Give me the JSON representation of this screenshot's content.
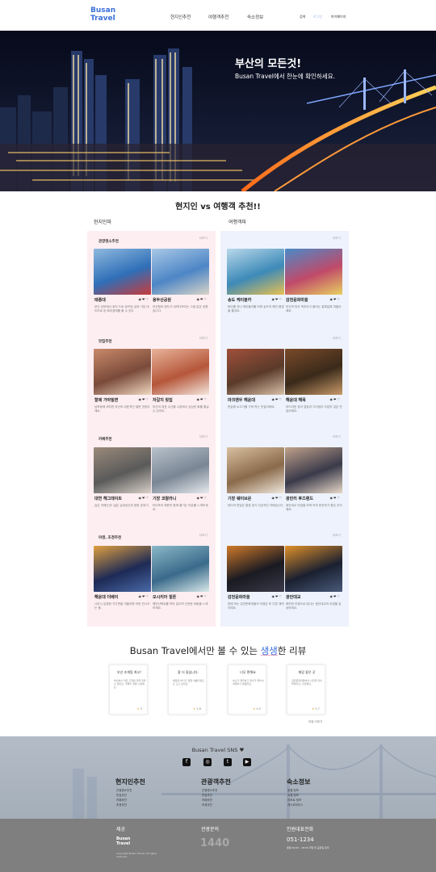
{
  "header": {
    "logo_line1": "Busan",
    "logo_line2": "Travel",
    "nav": [
      "현지인추천",
      "여행객추천",
      "숙소정보"
    ],
    "top_links": [
      "검색",
      "로그인",
      "마이페이지"
    ]
  },
  "hero": {
    "title": "부산의 모든것!",
    "subtitle": "Busan Travel에서 한눈에 확인하세요."
  },
  "recommend": {
    "title": "현지인 vs 여행객 추천!!",
    "left_label": "현지인파",
    "right_label": "여행객파",
    "more": "더보기",
    "left_categories": [
      "관광명소추천",
      "맛집추천",
      "카페추천",
      "야경, 조경추천"
    ],
    "left_cards": [
      {
        "name": "태종대",
        "desc": "부산 남부에서 위치 드로 꿈꾸었 길과 기업 대리자로 된 배이경에를 볼 수 있도"
      },
      {
        "name": "용두산공원",
        "desc": "부산항과 영도가 내려다보이는 그림 같은 공원입니다."
      },
      {
        "name": "할매 가야밀면",
        "desc": "남포동에 위치한 부산의 대표적인 밀면 맛집이에요."
      },
      {
        "name": "자갈치 횟집",
        "desc": "부산의 대표 수산물 시장에서 싱싱한 회를 즐길 수 있어요."
      },
      {
        "name": "대연 헤그데이트",
        "desc": "숨은 카페인것! 넓은 실내공간과 편한 분위기."
      },
      {
        "name": "기장 코랄라니",
        "desc": "타이포의 해변과 함께 즐기는 여유를 느껴보세요."
      },
      {
        "name": "해운대 더베이",
        "desc": "나무시 유명한 거주면을 겨울저편 어린 전시오는 품."
      },
      {
        "name": "오시리아 힐튼",
        "desc": "해안산책로를 따라 걸으며 산뜻한 바람을 느껴보세요."
      }
    ],
    "right_cards": [
      {
        "name": "송도 케이블카",
        "desc": "바다를 건너 케이블카를 타며 송도의 해안 풍경을 즐겨요."
      },
      {
        "name": "감천문화마을",
        "desc": "부산의 마추 픽추라고 불리는 알록달록 마을이에요."
      },
      {
        "name": "마크맨우 해운대",
        "desc": "한입에 소고기를 구워 먹는 맛집이에요."
      },
      {
        "name": "해운대 해목",
        "desc": "부드러운 장어 덮밥과 기다림이 아깝지 않은 맛집이에요."
      },
      {
        "name": "기장 웨이브온",
        "desc": "바다와 맞닿은 통창 뷰가 인상적인 카페입니다."
      },
      {
        "name": "광안리 후즈랜드",
        "desc": "광안대교 야경을 보며 커피 한잔하기 좋은 곳이에요."
      },
      {
        "name": "감천문화마을",
        "desc": "밤에 보는 감천문화마을의 야경은 또 다른 매력이에요."
      },
      {
        "name": "광안대교",
        "desc": "화려한 조명으로 빛나는 광안대교의 야경을 감상하세요."
      }
    ]
  },
  "reviews": {
    "title_pre": "Busan Travel에서만 볼 수 있는 ",
    "title_hl": "생생",
    "title_post": "한 리뷰",
    "cards": [
      {
        "title": "부산 조개탕 최고!",
        "body": "부산에서 먹은 조개탕 맛을 잊을 수 없어요. 국물이 정말 시원해요.",
        "rating": "5"
      },
      {
        "title": "좋 더 좋습니다.",
        "body": "해운대 바다가 정말 아름다워요. 또 오고 싶어요.",
        "rating": "4.8"
      },
      {
        "title": "너무 편해요",
        "body": "숙소가 깨끗하고 위치가 좋아서 여행하기 편했어요.",
        "rating": "4.9"
      },
      {
        "title": "재밌 좋은 곳",
        "body": "감천문화마을에서 사진을 많이 찍었어요. 추천해요.",
        "rating": "4.7"
      }
    ],
    "more": "리뷰 더보기"
  },
  "footer": {
    "sns_title": "Busan Travel SNS",
    "cols": [
      {
        "title": "현지인추천",
        "links": [
          "관광명소추천",
          "맛집추천",
          "카페추천",
          "조경추천"
        ]
      },
      {
        "title": "관광객추천",
        "links": [
          "관광명소추천",
          "맛집추천",
          "카페추천",
          "조경추천"
        ]
      },
      {
        "title": "숙소정보",
        "links": [
          "호텔 정보",
          "모텔 정보",
          "리조트 정보",
          "게스트하우스"
        ]
      }
    ],
    "bottom": {
      "col1_title": "제공",
      "logo_line1": "Busan",
      "logo_line2": "Travel",
      "copyright": "Copyright Busan Travel. All rights reserved.",
      "col2_title": "관광문의",
      "number": "1440",
      "col3_title": "인원대표전화",
      "phone": "051-1234",
      "hours": "평일 09:00 - 18:00 주말 및 공휴일 휴무"
    }
  },
  "colors": {
    "accent": "#3a6fd8",
    "pink_panel": "#fdeef2",
    "blue_panel": "#eef2fc",
    "star": "#f2a33a"
  }
}
